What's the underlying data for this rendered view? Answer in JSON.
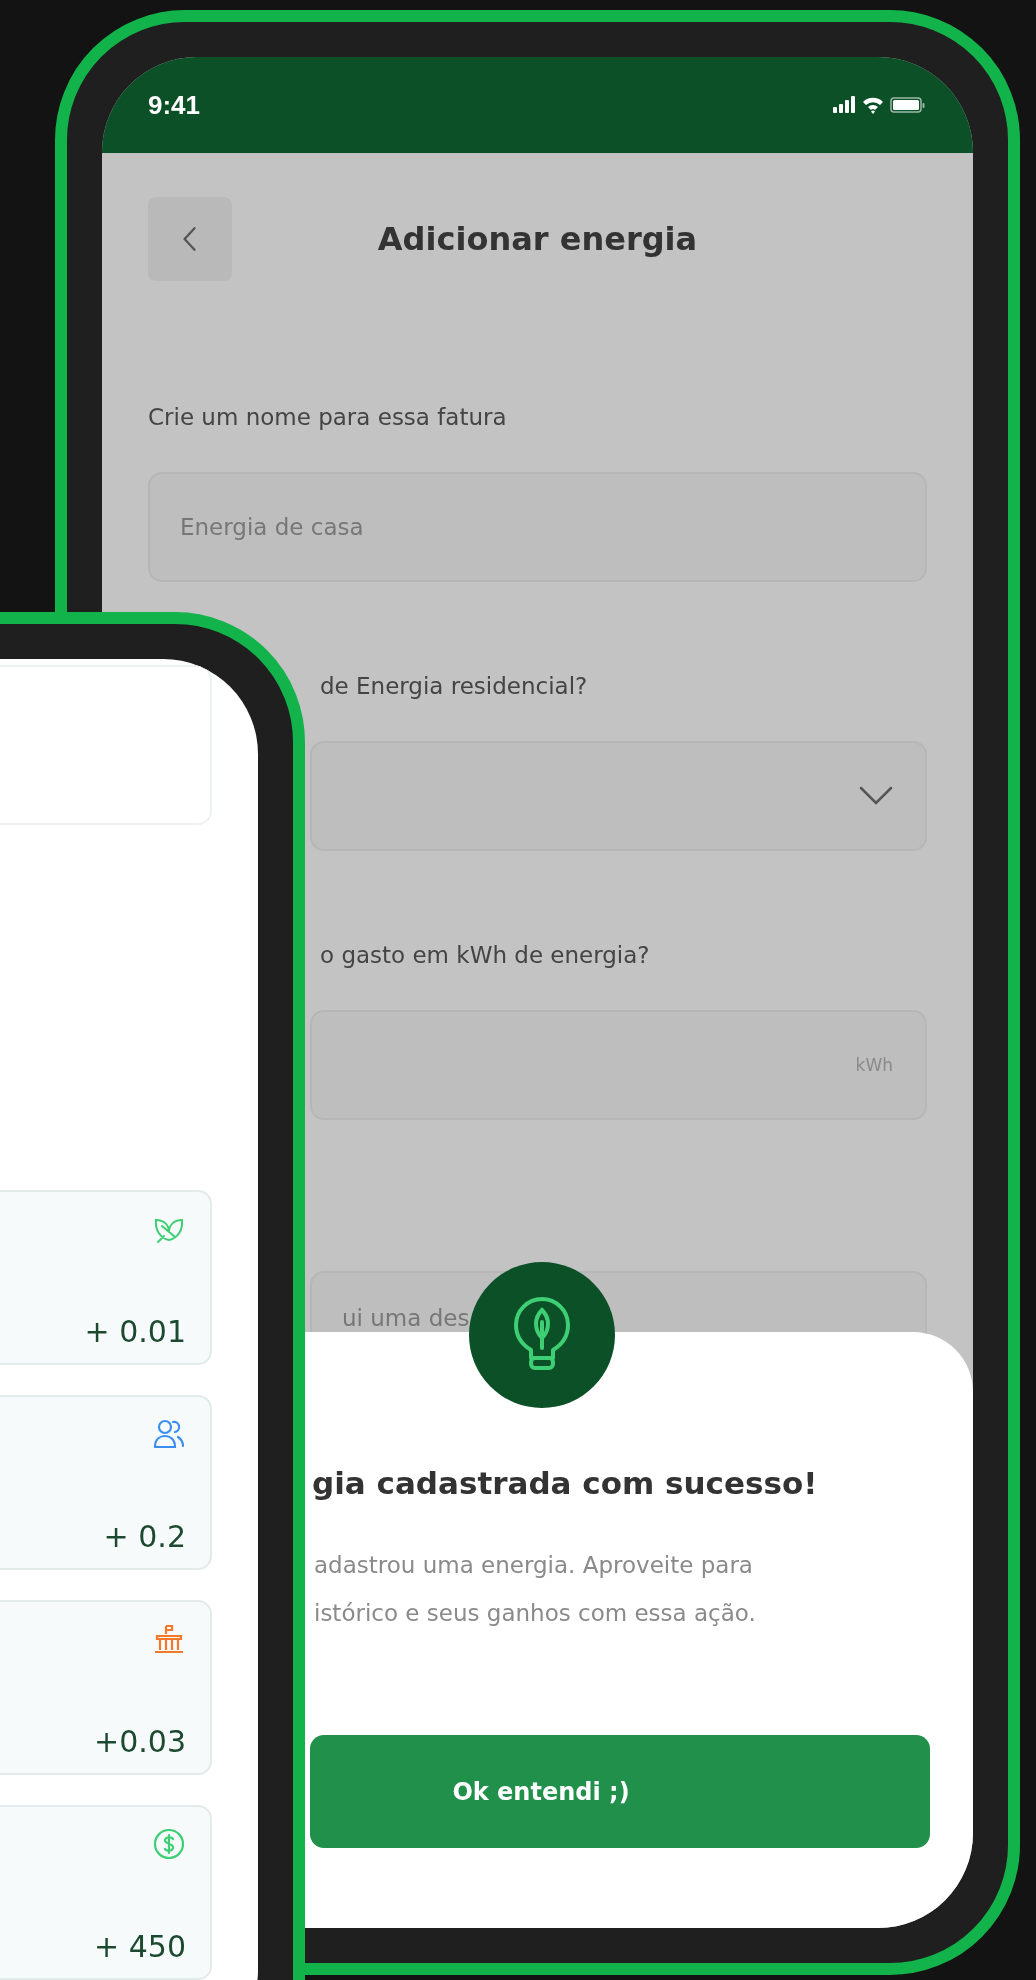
{
  "back_phone": {
    "status_bar": {
      "time": "9:41"
    },
    "header": {
      "title": "Adicionar energia"
    },
    "form": [
      {
        "kind": "text",
        "label": "Crie um nome para essa fatura",
        "placeholder": "Energia de casa"
      },
      {
        "kind": "select",
        "label": "de Energia residencial?"
      },
      {
        "kind": "unit",
        "label": "o gasto em kWh de energia?",
        "unit": "kWh"
      },
      {
        "kind": "text",
        "placeholder": "ui uma des"
      }
    ],
    "dialog": {
      "title": "gia cadastrada com sucesso!",
      "body_lines": [
        "adastrou uma energia. Aproveite para",
        "istórico e seus ganhos com essa ação."
      ],
      "button": "Ok entendi ;)"
    }
  },
  "front_phone": {
    "stat_cards": [
      {
        "kind": "leaf",
        "color": "#3ecf74",
        "value": "+ 0.01"
      },
      {
        "kind": "people",
        "color": "#3b8ef0",
        "value": "+ 0.2"
      },
      {
        "kind": "building",
        "color": "#f07a2a",
        "value": "+0.03"
      },
      {
        "kind": "money",
        "color": "#3ecf74",
        "value": "+ 450"
      }
    ]
  }
}
